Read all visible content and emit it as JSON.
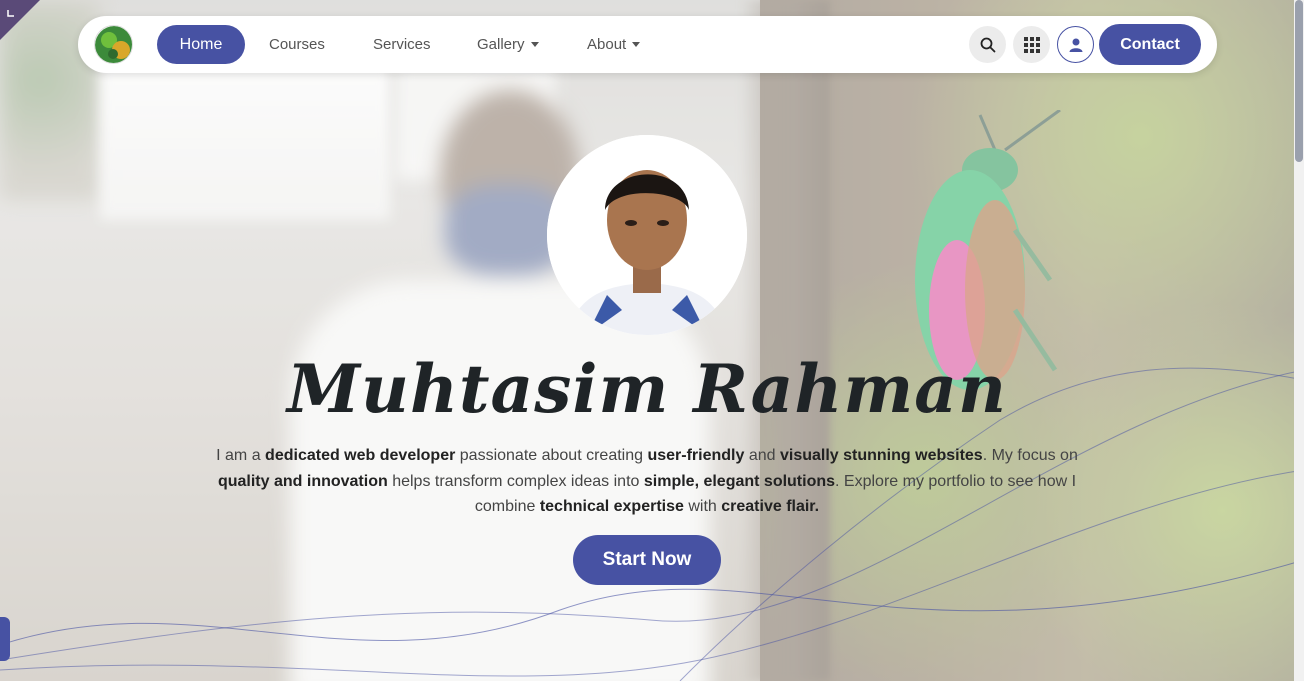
{
  "nav": {
    "logo_icon": "profile-logo-icon",
    "items": [
      {
        "label": "Home",
        "active": true
      },
      {
        "label": "Courses"
      },
      {
        "label": "Services"
      },
      {
        "label": "Gallery",
        "has_dropdown": true
      },
      {
        "label": "About",
        "has_dropdown": true
      }
    ],
    "search_icon": "search-icon",
    "apps_icon": "grid-apps-icon",
    "user_icon": "user-icon",
    "contact_label": "Contact"
  },
  "hero": {
    "name": "Muhtasim Rahman",
    "description": [
      {
        "text": "I am a ",
        "bold": false
      },
      {
        "text": "dedicated web developer",
        "bold": true
      },
      {
        "text": " passionate about creating ",
        "bold": false
      },
      {
        "text": "user-friendly",
        "bold": true
      },
      {
        "text": " and ",
        "bold": false
      },
      {
        "text": "visually stunning websites",
        "bold": true
      },
      {
        "text": ". My focus on ",
        "bold": false
      },
      {
        "text": "quality and innovation",
        "bold": true
      },
      {
        "text": " helps transform complex ideas into ",
        "bold": false
      },
      {
        "text": "simple, elegant solutions",
        "bold": true
      },
      {
        "text": ". Explore my portfolio to see how I combine ",
        "bold": false
      },
      {
        "text": "technical expertise",
        "bold": true
      },
      {
        "text": " with ",
        "bold": false
      },
      {
        "text": "creative flair.",
        "bold": true
      }
    ],
    "cta_label": "Start Now"
  },
  "colors": {
    "brand": "#4752a3",
    "text_dark": "#1f2427",
    "nav_text": "#555555"
  }
}
